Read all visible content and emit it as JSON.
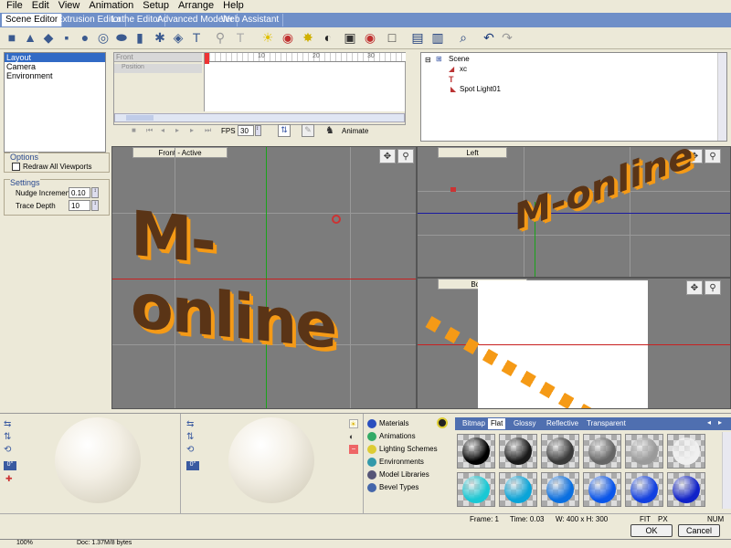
{
  "menu": [
    "File",
    "Edit",
    "View",
    "Animation",
    "Setup",
    "Arrange",
    "Help"
  ],
  "tabs": [
    "Scene Editor",
    "Extrusion Editor",
    "Lathe Editor",
    "Advanced Modeler",
    "Web Assistant"
  ],
  "layout_list": [
    "Layout",
    "Camera",
    "Environment"
  ],
  "options": {
    "title": "Options",
    "redraw": "Redraw All Viewports"
  },
  "settings": {
    "title": "Settings",
    "nudge_label": "Nudge Increment",
    "nudge_value": "0.10",
    "trace_label": "Trace Depth",
    "trace_value": "10"
  },
  "timeline": {
    "track": "Front",
    "sub": "Position",
    "ticks": [
      "10",
      "20",
      "30"
    ],
    "fps_label": "FPS",
    "fps_value": "30",
    "animate": "Animate"
  },
  "scene_tree": {
    "root": "Scene",
    "items": [
      "xc",
      "T",
      "Spot Light01"
    ]
  },
  "viewports": {
    "front": "Front - Active",
    "left": "Left",
    "bottom": "Bottom"
  },
  "text3d": "M-online",
  "library": [
    "Materials",
    "Animations",
    "Lighting Schemes",
    "Environments",
    "Model Libraries",
    "Bevel Types"
  ],
  "swatch_tabs": [
    "Bitmap",
    "Flat",
    "Glossy",
    "Reflective",
    "Transparent"
  ],
  "swatches_row1": [
    "#000000",
    "#1a1a1a",
    "#3a3a3a",
    "#666666",
    "#9a9a9a",
    "#f0f0f0"
  ],
  "swatches_row2": [
    "#19c8d4",
    "#0aa4d8",
    "#0a6fe0",
    "#0a56ea",
    "#1240e0",
    "#1022c8"
  ],
  "status": {
    "frame": "Frame: 1",
    "time": "Time: 0.03",
    "size": "W: 400 x H: 300",
    "fit": "FIT",
    "px": "PX",
    "num": "NUM"
  },
  "buttons": {
    "ok": "OK",
    "cancel": "Cancel"
  },
  "taskbar": {
    "zoom": "100%",
    "doc": "Doc: 1.37M/8 bytes"
  },
  "colors": {
    "tab_bar": "#6f8fc8",
    "accent": "#316ac5",
    "text_orange": "#f59a16",
    "text_brown": "#5a3416"
  }
}
